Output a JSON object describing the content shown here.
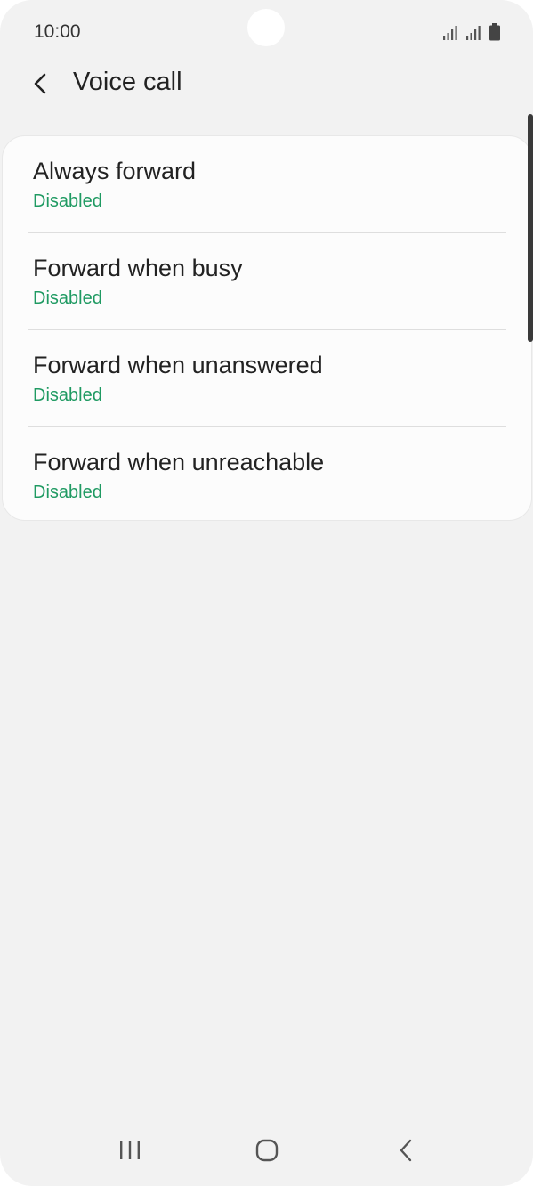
{
  "status_bar": {
    "time": "10:00"
  },
  "header": {
    "title": "Voice call"
  },
  "items": [
    {
      "title": "Always forward",
      "status": "Disabled"
    },
    {
      "title": "Forward when busy",
      "status": "Disabled"
    },
    {
      "title": "Forward when unanswered",
      "status": "Disabled"
    },
    {
      "title": "Forward when unreachable",
      "status": "Disabled"
    }
  ],
  "colors": {
    "accent": "#1f9a62",
    "background": "#f2f2f2",
    "card": "#fcfcfc"
  },
  "icons": {
    "back": "chevron-left-icon",
    "signal": "signal-bars-icon",
    "battery": "battery-icon",
    "recents": "recent-apps-icon",
    "home": "home-icon",
    "nav_back": "back-icon"
  }
}
